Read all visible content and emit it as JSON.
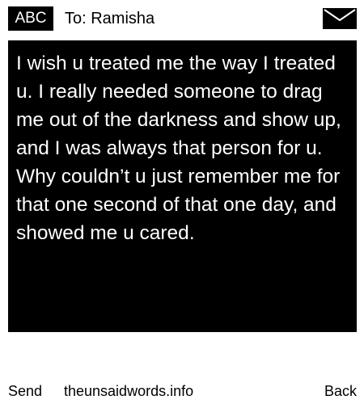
{
  "header": {
    "input_mode": "ABC",
    "recipient_label": "To: Ramisha",
    "icon": "envelope-icon"
  },
  "message": {
    "body": "I wish u treated me the way I treated u. I really needed someone to drag me out of the darkness and show up, and I was always that person for u. Why couldn’t u just remember me for that one second of that one day, and showed me u cared."
  },
  "footer": {
    "left_softkey": "Send",
    "center_text": "theunsaidwords.info",
    "right_softkey": "Back"
  },
  "colors": {
    "background": "#ffffff",
    "message_background": "#000000",
    "message_text": "#ffffff",
    "text": "#000000"
  }
}
